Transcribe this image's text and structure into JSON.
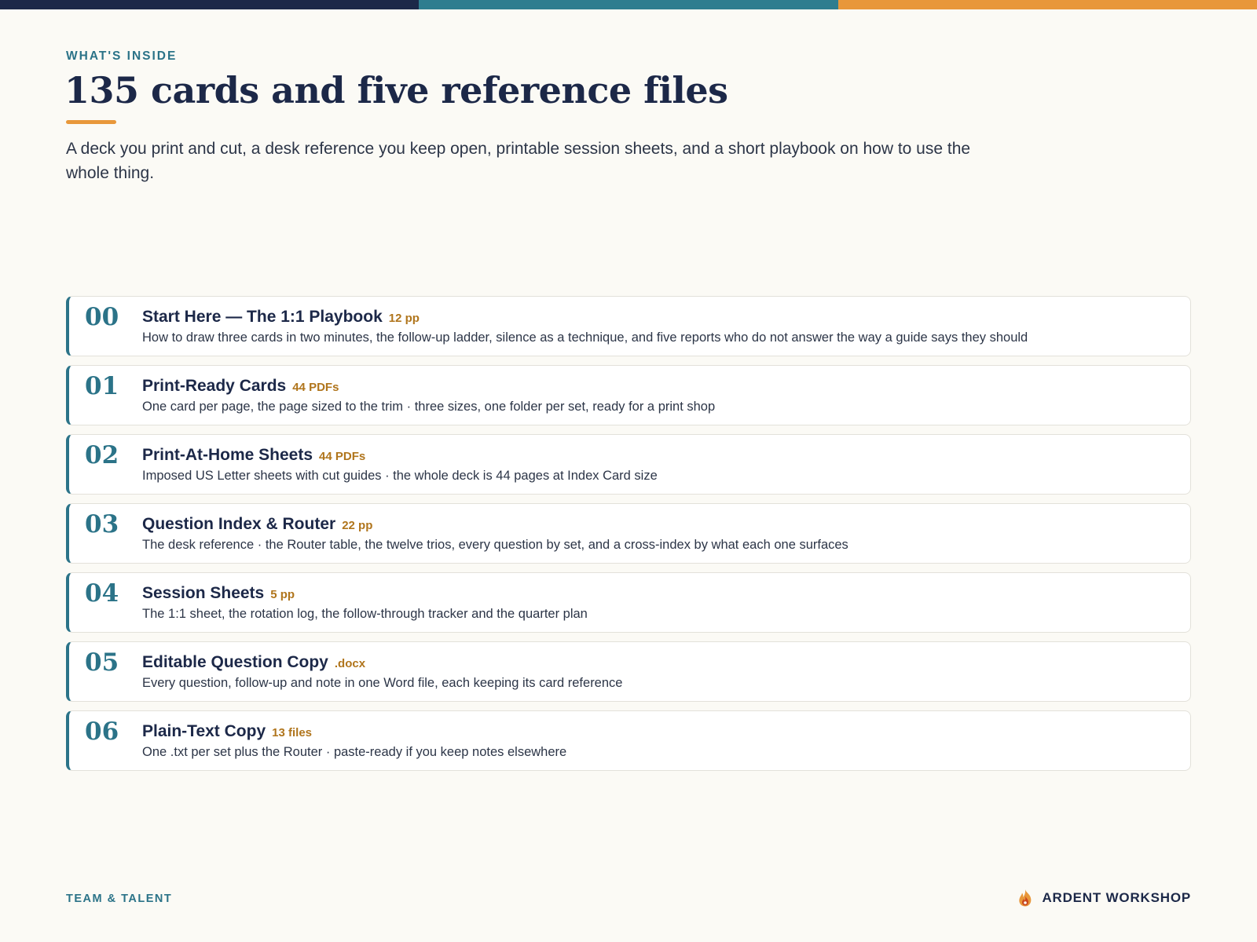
{
  "colors": {
    "navy": "#1c2848",
    "teal": "#2e7d8f",
    "orange": "#e8973a",
    "tag": "#b0751c",
    "background": "#fbfaf5"
  },
  "header": {
    "eyebrow": "WHAT'S INSIDE",
    "title": "135 cards and five reference files",
    "intro": "A deck you print and cut, a desk reference you keep open, printable session sheets, and a short playbook on how to use the whole thing."
  },
  "items": [
    {
      "number": "00",
      "title": "Start Here — The 1:1 Playbook",
      "tag": "12 pp",
      "description": "How to draw three cards in two minutes, the follow-up ladder, silence as a technique, and five reports who do not answer the way a guide says they should"
    },
    {
      "number": "01",
      "title": "Print-Ready Cards",
      "tag": "44 PDFs",
      "description": "One card per page, the page sized to the trim · three sizes, one folder per set, ready for a print shop"
    },
    {
      "number": "02",
      "title": "Print-At-Home Sheets",
      "tag": "44 PDFs",
      "description": "Imposed US Letter sheets with cut guides · the whole deck is 44 pages at Index Card size"
    },
    {
      "number": "03",
      "title": "Question Index & Router",
      "tag": "22 pp",
      "description": "The desk reference · the Router table, the twelve trios, every question by set, and a cross-index by what each one surfaces"
    },
    {
      "number": "04",
      "title": "Session Sheets",
      "tag": "5 pp",
      "description": "The 1:1 sheet, the rotation log, the follow-through tracker and the quarter plan"
    },
    {
      "number": "05",
      "title": "Editable Question Copy",
      "tag": ".docx",
      "description": "Every question, follow-up and note in one Word file, each keeping its card reference"
    },
    {
      "number": "06",
      "title": "Plain-Text Copy",
      "tag": "13 files",
      "description": "One .txt per set plus the Router · paste-ready if you keep notes elsewhere"
    }
  ],
  "footer": {
    "left": "TEAM & TALENT",
    "brand": "ARDENT WORKSHOP",
    "brand_icon": "flame-icon"
  }
}
